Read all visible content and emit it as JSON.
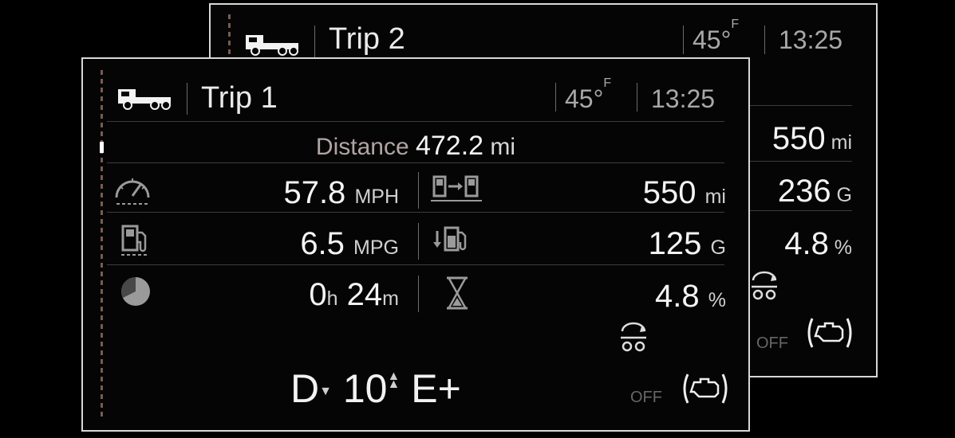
{
  "trip2": {
    "title": "Trip 2",
    "temp_value": "45°",
    "temp_unit": "F",
    "time": "13:25",
    "rows": [
      {
        "value": "550",
        "unit": " mi"
      },
      {
        "value": "236",
        "unit": " G"
      },
      {
        "value": "4.8",
        "unit": " %"
      }
    ],
    "off_label": "OFF"
  },
  "trip1": {
    "title": "Trip 1",
    "temp_value": "45°",
    "temp_unit": "F",
    "time": "13:25",
    "distance_label": "Distance",
    "distance_value": "472.2",
    "distance_unit": "mi",
    "speed_value": "57.8",
    "speed_unit": "MPH",
    "range_value": "550",
    "range_unit": "mi",
    "economy_value": "6.5",
    "economy_unit": "MPG",
    "fuel_used_value": "125",
    "fuel_used_unit": "G",
    "time_hours": "0",
    "time_hours_unit": "h",
    "time_minutes": "24",
    "time_minutes_unit": "m",
    "idle_value": "4.8",
    "idle_unit": "%",
    "gear_mode": "D",
    "gear_number": "10",
    "gear_range": "E+",
    "off_label": "OFF"
  },
  "icons": [
    "truck-icon",
    "speedometer-icon",
    "fuel-range-icon",
    "fuel-pump-icon",
    "fuel-used-icon",
    "trip-time-icon",
    "hourglass-icon",
    "axle-lift-icon",
    "engine-brake-icon"
  ],
  "colors": {
    "background": "#000000",
    "frame": "#d8d8d8",
    "text": "#f4f4f4",
    "dim": "#a8a8a8"
  }
}
